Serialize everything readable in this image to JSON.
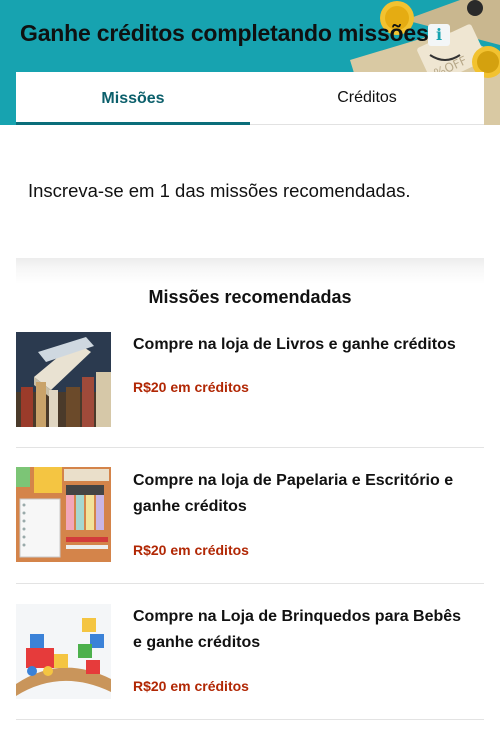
{
  "header": {
    "title": "Ganhe créditos completando missões",
    "info_icon": "i",
    "background": "#17a3b0"
  },
  "tabs": [
    {
      "label": "Missões",
      "active": true
    },
    {
      "label": "Créditos",
      "active": false
    }
  ],
  "intro": "Inscreva-se em 1 das missões recomendadas.",
  "section_title": "Missões recomendadas",
  "missions": [
    {
      "title": "Compre na loja de Livros e ganhe créditos",
      "credit": "R$20 em créditos",
      "image": "books-image"
    },
    {
      "title": "Compre na loja de Papelaria e Escritório e ganhe créditos",
      "credit": "R$20 em créditos",
      "image": "stationery-image"
    },
    {
      "title": "Compre na Loja de Brinquedos para Bebês e ganhe créditos",
      "credit": "R$20 em créditos",
      "image": "baby-toys-image"
    }
  ],
  "colors": {
    "accent": "#0b6e7a",
    "credit": "#b12704"
  }
}
